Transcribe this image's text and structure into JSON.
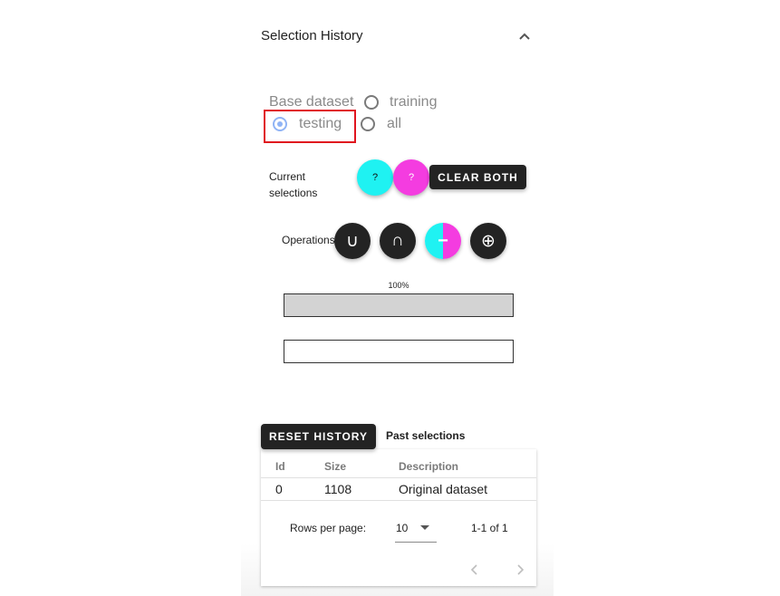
{
  "panel": {
    "title": "Selection History"
  },
  "base_dataset": {
    "label": "Base dataset",
    "options": [
      {
        "label": "training",
        "selected": false
      },
      {
        "label": "testing",
        "selected": true
      },
      {
        "label": "all",
        "selected": false
      }
    ]
  },
  "current_selections": {
    "label": "Current selections",
    "selection_a": "?",
    "selection_b": "?",
    "clear_label": "CLEAR BOTH"
  },
  "operations": {
    "label": "Operations",
    "union_symbol": "∪",
    "intersection_symbol": "∩",
    "difference_symbol": "−",
    "symmetric_difference_symbol": "⊕"
  },
  "progress": {
    "label": "100%",
    "value": 1.0
  },
  "history": {
    "reset_label": "RESET HISTORY",
    "past_label": "Past selections",
    "columns": [
      "Id",
      "Size",
      "Description"
    ],
    "rows": [
      {
        "id": "0",
        "size": "1108",
        "description": "Original dataset"
      }
    ],
    "rows_per_page_label": "Rows per page:",
    "rows_per_page_value": "10",
    "range_text": "1-1 of 1"
  },
  "colors": {
    "selection_a": "#1ff2f2",
    "selection_b": "#f43ce0",
    "dark_button": "#232323",
    "radio_selected": "#90b4f5",
    "highlight_box": "#e0151f"
  },
  "icons": {
    "collapse": "chevron-up-icon",
    "prev_page": "chevron-left-icon",
    "next_page": "chevron-right-icon",
    "dropdown": "caret-down-icon"
  }
}
